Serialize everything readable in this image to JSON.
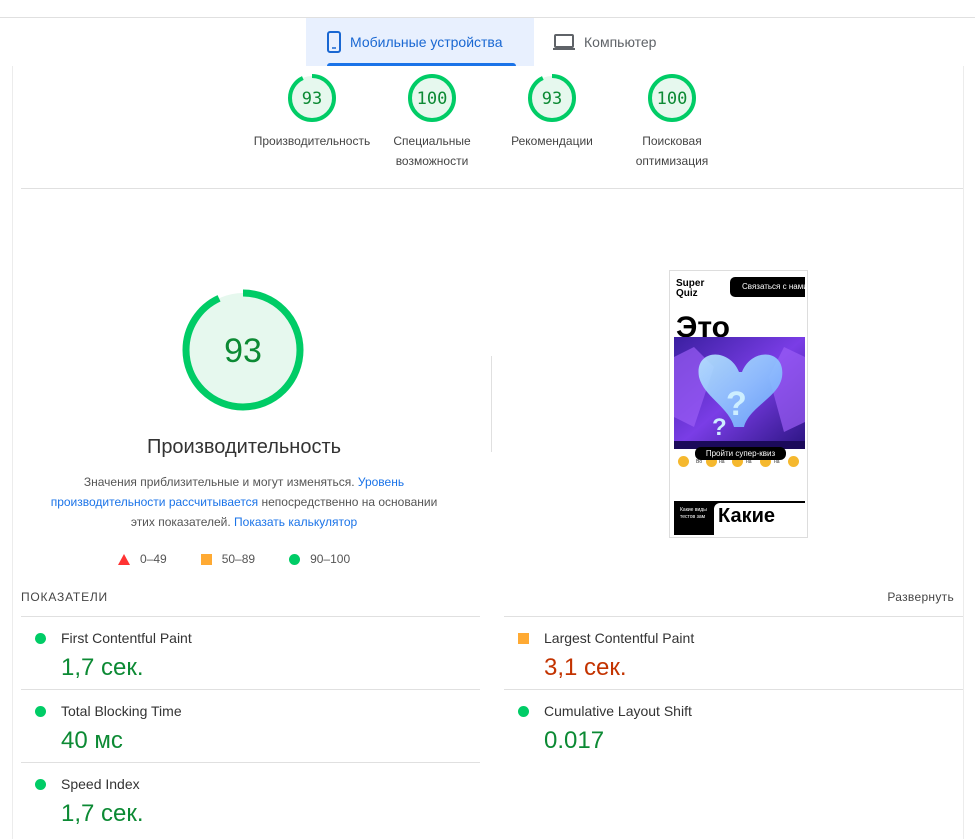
{
  "tabs": {
    "mobile": "Мобильные устройства",
    "desktop": "Компьютер"
  },
  "categories": [
    {
      "score": "93",
      "value": 93,
      "label": "Производительность"
    },
    {
      "score": "100",
      "value": 100,
      "label": "Специальные возможности"
    },
    {
      "score": "93",
      "value": 93,
      "label": "Рекомендации"
    },
    {
      "score": "100",
      "value": 100,
      "label": "Поисковая оптимизация"
    }
  ],
  "performance": {
    "score": "93",
    "value": 93,
    "title": "Производительность",
    "desc_start": "Значения приблизительные и могут изменяться. ",
    "desc_link1": "Уровень производительности рассчитывается",
    "desc_mid": " непосредственно на основании этих показателей. ",
    "desc_link2": "Показать калькулятор"
  },
  "legend": {
    "fail": "0–49",
    "average": "50–89",
    "pass": "90–100"
  },
  "thumbnail": {
    "logo_line1": "Super",
    "logo_line2": "Quiz",
    "cta": "Связаться с нами",
    "hero": "Это",
    "quiz_button": "Пройти супер-квиз",
    "card_text": "Какие виды тестов зам",
    "bottom": "Какие"
  },
  "metrics": {
    "header": "ПОКАЗАТЕЛИ",
    "expand": "Развернуть",
    "fcp": {
      "name": "First Contentful Paint",
      "value": "1,7 сек."
    },
    "lcp": {
      "name": "Largest Contentful Paint",
      "value": "3,1 сек."
    },
    "tbt": {
      "name": "Total Blocking Time",
      "value": "40 мс"
    },
    "cls": {
      "name": "Cumulative Layout Shift",
      "value": "0.017"
    },
    "si": {
      "name": "Speed Index",
      "value": "1,7 сек."
    }
  },
  "colors": {
    "pass": "#00cc66",
    "pass_text": "#0c8a34",
    "average": "#ffaa33",
    "fail": "#ff3333",
    "fail_text": "#c33300",
    "accent": "#1a73e8"
  }
}
